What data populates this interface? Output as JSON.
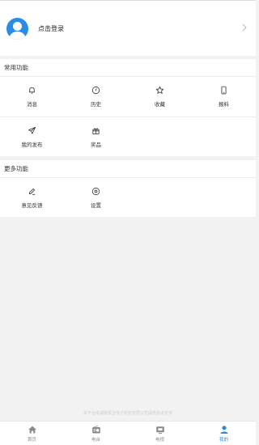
{
  "profile": {
    "login_label": "点击登录"
  },
  "common": {
    "title": "常用功能",
    "items": [
      {
        "label": "消息",
        "icon": "bell-icon"
      },
      {
        "label": "历史",
        "icon": "clock-icon"
      },
      {
        "label": "收藏",
        "icon": "star-icon"
      },
      {
        "label": "报料",
        "icon": "phone-icon"
      },
      {
        "label": "我的发布",
        "icon": "send-icon"
      },
      {
        "label": "奖品",
        "icon": "gift-icon"
      }
    ]
  },
  "more": {
    "title": "更多功能",
    "items": [
      {
        "label": "意见反馈",
        "icon": "pencil-icon"
      },
      {
        "label": "设置",
        "icon": "settings-icon"
      }
    ]
  },
  "footer": {
    "note": "本平台由湖南报业电子科技有限公司提供技术支持"
  },
  "tabbar": {
    "items": [
      {
        "label": "首页",
        "icon": "home-icon",
        "active": false
      },
      {
        "label": "电台",
        "icon": "radio-icon",
        "active": false
      },
      {
        "label": "电视",
        "icon": "tv-icon",
        "active": false
      },
      {
        "label": "我的",
        "icon": "user-icon",
        "active": true
      }
    ]
  },
  "colors": {
    "accent": "#2b8ce6",
    "background": "#f2f2f2",
    "icon_gray": "#9a9a9a"
  }
}
